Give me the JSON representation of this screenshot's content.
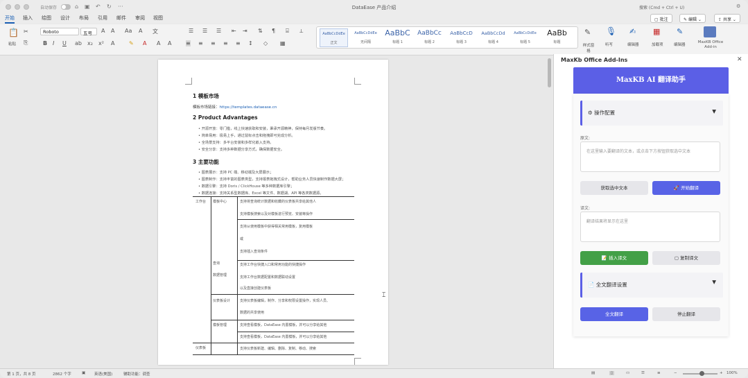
{
  "title_bar": {
    "autosave_label": "自动保存",
    "document_title": "DataEase 产品介绍",
    "search_placeholder": "搜索 (Cmd + Ctrl + U)"
  },
  "ribbon_tabs": [
    "开始",
    "插入",
    "绘图",
    "设计",
    "布局",
    "引用",
    "邮件",
    "审阅",
    "视图"
  ],
  "title_actions": {
    "comment": "批注",
    "edit": "编辑",
    "share": "共享"
  },
  "ribbon": {
    "paste": "粘贴",
    "font_name": "Roboto",
    "font_size": "五号",
    "styles": [
      {
        "preview": "AaBbCcDdEe",
        "label": "正文"
      },
      {
        "preview": "AaBbCcDdEe",
        "label": "无间隔"
      },
      {
        "preview": "AaBbC",
        "label": "标题 1"
      },
      {
        "preview": "AaBbCc",
        "label": "标题 2"
      },
      {
        "preview": "AaBbCcD",
        "label": "标题 3"
      },
      {
        "preview": "AaBbCcDd",
        "label": "标题 4"
      },
      {
        "preview": "AaBbCcDdEe",
        "label": "标题 5"
      },
      {
        "preview": "AaBb",
        "label": "标题"
      }
    ],
    "styles_pane": "样式窗格",
    "dictate": "听写",
    "editor": "编辑器",
    "addins": "加载项",
    "editor2": "编辑器",
    "maxkb": "MaxKB Office Add-in"
  },
  "document": {
    "h_market": "1 模板市场",
    "market_link_label": "模板市场链接：",
    "market_link": "https://templates.dataease.cn",
    "h_adv": "2 Product Advantages",
    "adv_bullets": [
      "开源开放：零门槛，线上快速获取和安装，秉承开源精神，保持每月发版节奏。",
      "简单易用：极易上手，通过鼠标点击和拖拽即可完成分析。",
      "全场景支持：多平台安装和多样化嵌入支持。",
      "安全分享：支持多种数据分享方式，确保数据安全。"
    ],
    "h_func": "3 主要功能",
    "func_bullets": [
      "图表展示：支持 PC 端、移动端及大屏展示；",
      "图表制作：支持丰富的图表类型，支持报表拖拽式设计，帮助业务人员快速制作数据大屏；",
      "数据引擎：支持 Doris / ClickHouse 等多种数据库引擎；",
      "数据连接：支持关系型数据库、Excel 等文件、数据湖、API 等各类数据源。"
    ],
    "table": {
      "col1": [
        "工作台",
        "仪表板"
      ],
      "col2": [
        "模板中心",
        "查询",
        "数据管理",
        "仪表板设计",
        "模板管理"
      ],
      "rows": [
        "支持将查询统计数据和收藏的仪表板共享给其他人",
        "支持模板搜索以及对模板进行预览、安装等操作",
        "支持从使用模板中获得相关常用模板，复用模板",
        "或",
        "支持插入查询条件",
        "支持工作台快捷入口和常用功能的快捷操作",
        "支持工作台数据配置和数据联动设置",
        "以及直接创建仪表板",
        "支持仪表板编辑，制作、分享和权限设置操作，实现人员、",
        "数据的共享使用",
        "支持查看模板，DataEase 内置模板，并可以分享给其他",
        "支持查看模板，DataEase 内置模板，并可以分享给其他",
        "支持仪表板新建、编辑、删除、复制、移动、搜索"
      ]
    }
  },
  "addin": {
    "pane_title": "MaxKb Office Add-Ins",
    "header": "MaxKB AI 翻译助手",
    "config_title": "操作配置",
    "source_label": "原文:",
    "source_placeholder": "在这里输入要翻译的文本，或点击下方按钮获取选中文本",
    "btn_get": "获取选中文本",
    "btn_translate": "开始翻译",
    "target_label": "译文:",
    "target_placeholder": "翻译结果将显示在这里",
    "btn_insert": "插入译文",
    "btn_copy": "复制译文",
    "full_settings": "全文翻译设置",
    "btn_full": "全文翻译",
    "btn_stop": "停止翻译",
    "accent": "#5b5fe6"
  },
  "status_bar": {
    "page": "第 1 页，共 8 页",
    "words": "2862 个字",
    "lang": "英语(美国)",
    "focus": "辅助功能：调查",
    "zoom": "100%"
  }
}
